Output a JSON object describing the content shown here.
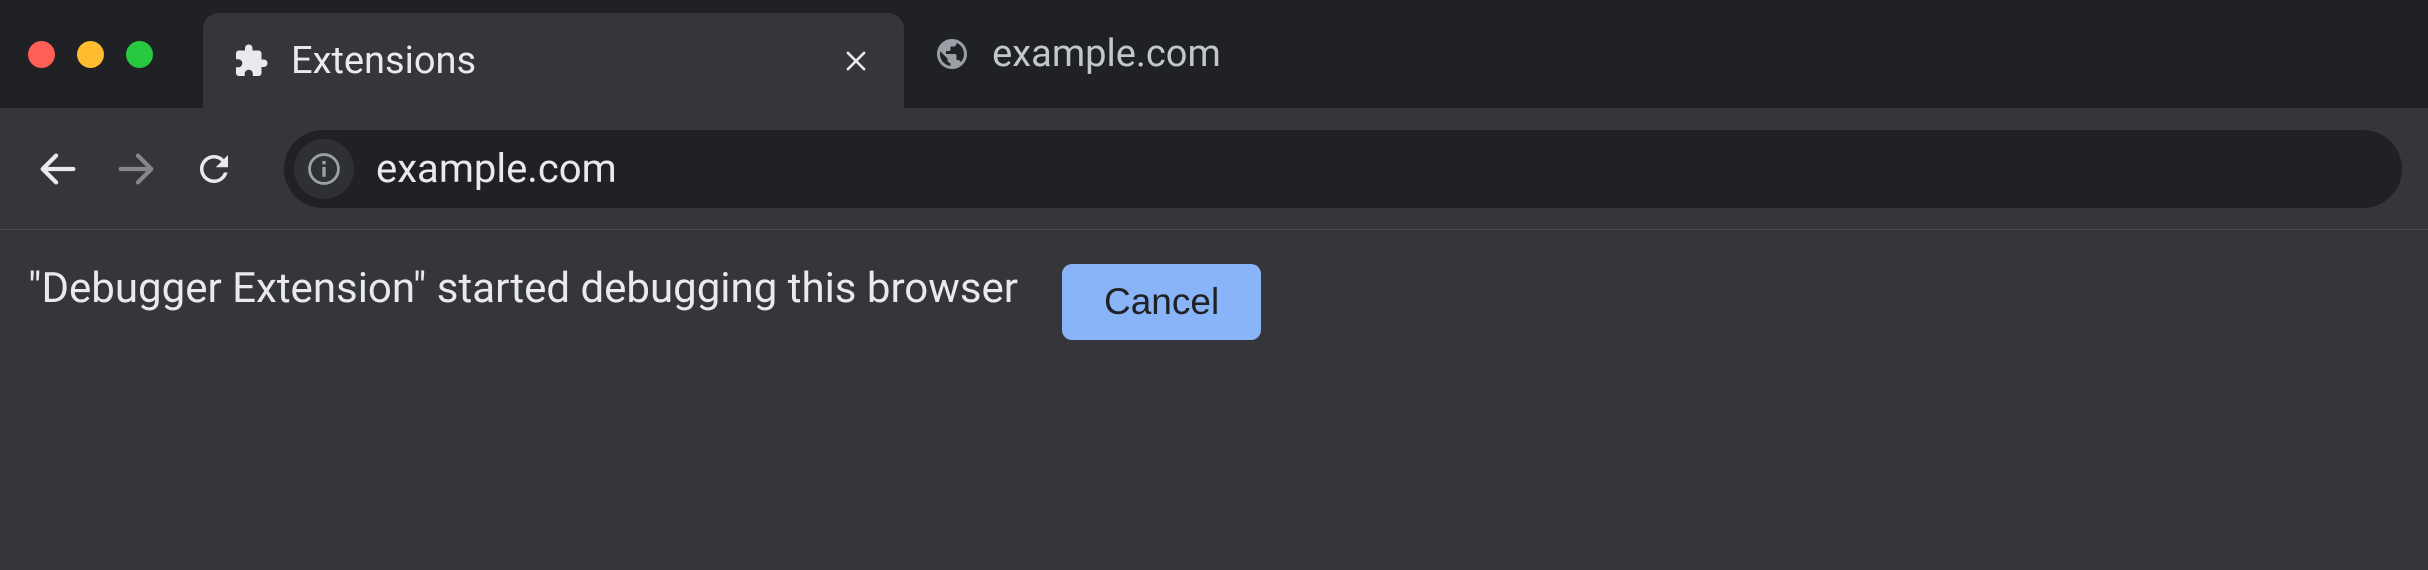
{
  "window_controls": {
    "close": "close",
    "minimize": "minimize",
    "maximize": "maximize"
  },
  "tabs": [
    {
      "title": "Extensions",
      "active": true,
      "icon": "extension-icon"
    },
    {
      "title": "example.com",
      "active": false,
      "icon": "globe-icon"
    }
  ],
  "nav": {
    "back_enabled": true,
    "forward_enabled": false,
    "reload_enabled": true
  },
  "address_bar": {
    "url": "example.com",
    "site_info_icon": "info-icon"
  },
  "infobar": {
    "message": "\"Debugger Extension\" started debugging this browser",
    "cancel_label": "Cancel"
  }
}
